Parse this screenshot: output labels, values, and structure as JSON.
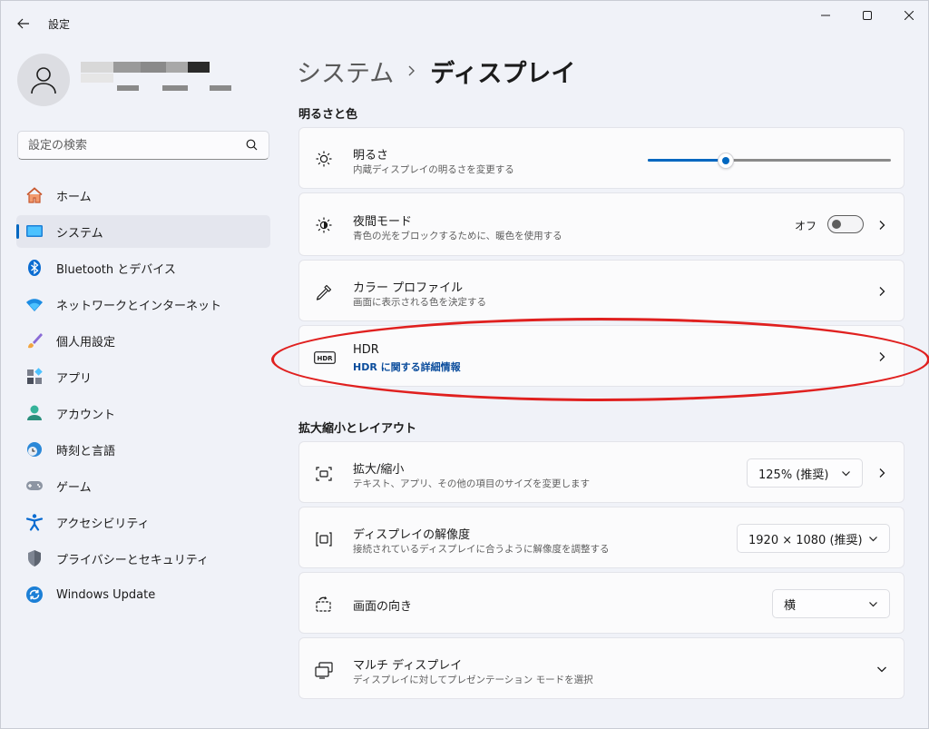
{
  "window": {
    "app_title": "設定",
    "controls": {
      "minimize": "minimize",
      "maximize": "maximize",
      "close": "close"
    }
  },
  "sidebar": {
    "search_placeholder": "設定の検索",
    "items": [
      {
        "label": "ホーム",
        "icon": "home-icon",
        "active": false
      },
      {
        "label": "システム",
        "icon": "system-icon",
        "active": true
      },
      {
        "label": "Bluetooth とデバイス",
        "icon": "bluetooth-icon",
        "active": false
      },
      {
        "label": "ネットワークとインターネット",
        "icon": "wifi-icon",
        "active": false
      },
      {
        "label": "個人用設定",
        "icon": "brush-icon",
        "active": false
      },
      {
        "label": "アプリ",
        "icon": "apps-icon",
        "active": false
      },
      {
        "label": "アカウント",
        "icon": "account-icon",
        "active": false
      },
      {
        "label": "時刻と言語",
        "icon": "time-language-icon",
        "active": false
      },
      {
        "label": "ゲーム",
        "icon": "gamepad-icon",
        "active": false
      },
      {
        "label": "アクセシビリティ",
        "icon": "accessibility-icon",
        "active": false
      },
      {
        "label": "プライバシーとセキュリティ",
        "icon": "shield-icon",
        "active": false
      },
      {
        "label": "Windows Update",
        "icon": "update-icon",
        "active": false
      }
    ]
  },
  "breadcrumb": {
    "parent": "システム",
    "current": "ディスプレイ"
  },
  "sections": {
    "brightness_color": "明るさと色",
    "scale_layout": "拡大縮小とレイアウト"
  },
  "brightness": {
    "title": "明るさ",
    "desc": "内蔵ディスプレイの明るさを変更する",
    "level": 0.32
  },
  "night_light": {
    "title": "夜間モード",
    "desc": "青色の光をブロックするために、暖色を使用する",
    "toggle_label": "オフ",
    "on": false
  },
  "color_profile": {
    "title": "カラー プロファイル",
    "desc": "画面に表示される色を決定する"
  },
  "hdr": {
    "title": "HDR",
    "link": "HDR に関する詳細情報",
    "icon_text": "HDR"
  },
  "scale": {
    "title": "拡大/縮小",
    "desc": "テキスト、アプリ、その他の項目のサイズを変更します",
    "value": "125% (推奨)"
  },
  "resolution": {
    "title": "ディスプレイの解像度",
    "desc": "接続されているディスプレイに合うように解像度を調整する",
    "value": "1920 × 1080 (推奨)"
  },
  "orientation": {
    "title": "画面の向き",
    "value": "横"
  },
  "multi_display": {
    "title": "マルチ ディスプレイ",
    "desc": "ディスプレイに対してプレゼンテーション モードを選択"
  },
  "colors": {
    "accent": "#0067c0",
    "annotation": "#e0201f"
  }
}
